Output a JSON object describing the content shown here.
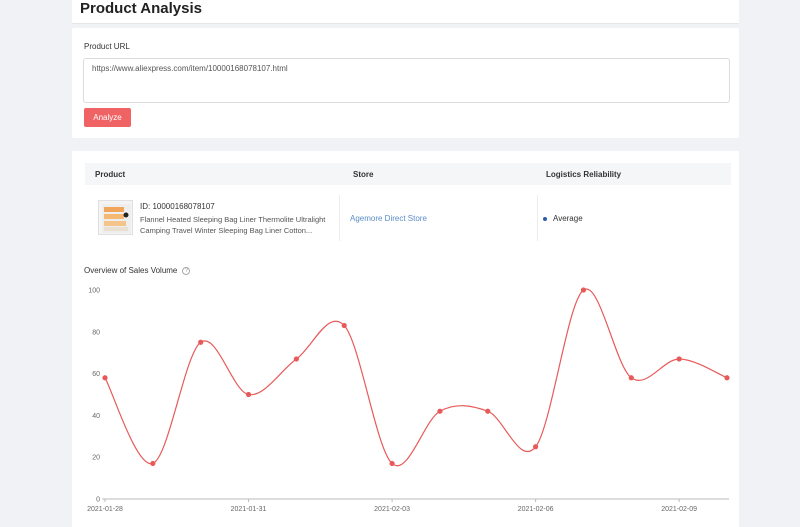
{
  "page": {
    "title": "Product Analysis"
  },
  "url_form": {
    "label": "Product URL",
    "value": "https://www.aliexpress.com/item/10000168078107.html",
    "button_label": "Analyze"
  },
  "table": {
    "headers": {
      "product": "Product",
      "store": "Store",
      "logistics": "Logistics Reliability"
    },
    "row": {
      "product_id": "ID: 10000168078107",
      "product_name": "Flannel Heated Sleeping Bag Liner Thermolite Ultralight Camping Travel Winter Sleeping Bag Liner Cotton...",
      "store": "Agemore Direct Store",
      "logistics": "Average",
      "logistics_color": "#2a5caa"
    }
  },
  "chart_section": {
    "title": "Overview of Sales Volume",
    "help_icon": "question-circle-icon"
  },
  "chart_data": {
    "type": "line",
    "x": [
      "2021-01-28",
      "2021-01-29",
      "2021-01-30",
      "2021-01-31",
      "2021-02-01",
      "2021-02-02",
      "2021-02-03",
      "2021-02-04",
      "2021-02-05",
      "2021-02-06",
      "2021-02-07",
      "2021-02-08",
      "2021-02-09",
      "2021-02-10"
    ],
    "x_tick_labels": [
      "2021-01-28",
      "2021-01-31",
      "2021-02-03",
      "2021-02-06",
      "2021-02-09"
    ],
    "series": [
      {
        "values": [
          58,
          17,
          75,
          50,
          67,
          83,
          17,
          42,
          42,
          25,
          100,
          58,
          67,
          58
        ]
      }
    ],
    "ylim": [
      0,
      100
    ],
    "y_ticks": [
      0,
      20,
      40,
      60,
      80,
      100
    ],
    "color": "#e85a5a",
    "grid": false
  }
}
